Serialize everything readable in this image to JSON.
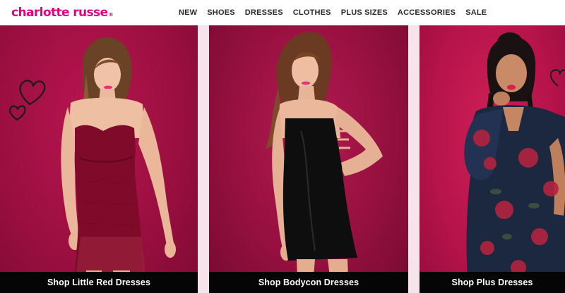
{
  "brand": {
    "logo_text": "charlotte russe",
    "logo_mark": "®",
    "color": "#e5007e"
  },
  "nav": {
    "items": [
      {
        "label": "NEW"
      },
      {
        "label": "SHOES"
      },
      {
        "label": "DRESSES"
      },
      {
        "label": "CLOTHES"
      },
      {
        "label": "PLUS SIZES"
      },
      {
        "label": "ACCESSORIES"
      },
      {
        "label": "SALE"
      }
    ]
  },
  "tiles": [
    {
      "cta": "Shop Little Red Dresses",
      "dress_color": "#7f0a2a",
      "image": "model-in-red-lace-dress"
    },
    {
      "cta": "Shop Bodycon Dresses",
      "dress_color": "#0e0e0e",
      "image": "model-in-black-bodycon-dress"
    },
    {
      "cta": "Shop Plus Dresses",
      "dress_color": "#1c2740",
      "image": "model-in-floral-mesh-dress"
    }
  ],
  "colors": {
    "cta_bar": "#050505",
    "divider": "#f6e4ea"
  }
}
